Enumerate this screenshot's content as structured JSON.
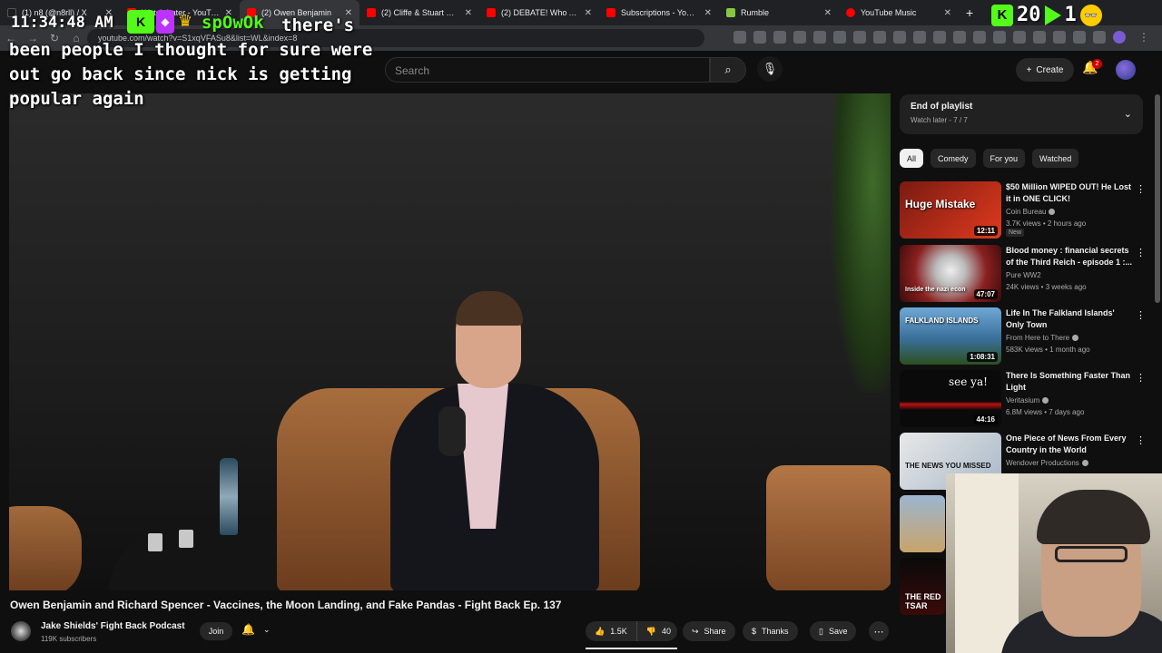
{
  "browser": {
    "tabs": [
      {
        "label": "(1) n8 (@n8rll) / X",
        "color": "#1d1d1d"
      },
      {
        "label": "Watch Later - YouTube",
        "color": "#ff0000"
      },
      {
        "label": "(2) Owen Benjamin",
        "color": "#ff0000",
        "active": true
      },
      {
        "label": "(2) Cliffe & Stuart Knech",
        "color": "#ff0000"
      },
      {
        "label": "(2) DEBATE! Who Are th",
        "color": "#ff0000"
      },
      {
        "label": "Subscriptions - YouTube",
        "color": "#ff0000"
      },
      {
        "label": "Rumble",
        "color": "#85c742"
      },
      {
        "label": "YouTube Music",
        "color": "#ff0000"
      }
    ],
    "new_tab": "+",
    "url": "youtube.com/watch?v=S1xqVFASu8&list=WL&index=8"
  },
  "stream_overlay": {
    "clock": "11:34:48 AM",
    "badge": "K",
    "username": "spOwOk",
    "message": "there's been people I thought for sure were out go back since nick is getting popular again",
    "top_right_k": "K",
    "top_right_num1": "20",
    "top_right_num2": "1"
  },
  "search": {
    "placeholder": "Search"
  },
  "masthead": {
    "create_label": "Create",
    "notification_count": "2"
  },
  "playlist": {
    "title": "End of playlist",
    "subtitle": "Watch later - 7 / 7"
  },
  "chips": [
    "All",
    "Comedy",
    "For you",
    "Watched"
  ],
  "recommendations": [
    {
      "title": "$50 Million WIPED OUT! He Lost it in ONE CLICK!",
      "channel": "Coin Bureau",
      "meta": "3.7K views • 2 hours ago",
      "duration": "12:11",
      "badge": "New",
      "thumb_text": "Huge Mistake",
      "thumb_color": "#7a1a12"
    },
    {
      "title": "Blood money : financial secrets of the Third Reich - episode 1 :...",
      "channel": "Pure WW2",
      "meta": "24K views • 3 weeks ago",
      "duration": "47:07",
      "thumb_text": "Inside the nazi econ",
      "thumb_color": "#8a2020"
    },
    {
      "title": "Life In The Falkland Islands' Only Town",
      "channel": "From Here to There",
      "meta": "583K views • 1 month ago",
      "duration": "1:08:31",
      "thumb_text": "FALKLAND ISLANDS",
      "thumb_color": "#3a6f9a"
    },
    {
      "title": "There Is Something Faster Than Light",
      "channel": "Veritasium",
      "meta": "6.8M views • 7 days ago",
      "duration": "44:16",
      "thumb_text": "see ya!",
      "thumb_color": "#0a0a0a"
    },
    {
      "title": "One Piece of News From Every Country in the World",
      "channel": "Wendover Productions",
      "meta": "",
      "duration": "",
      "thumb_text": "THE NEWS YOU MISSED",
      "thumb_color": "#d8d8d8"
    }
  ],
  "video": {
    "title": "Owen Benjamin and Richard Spencer - Vaccines, the Moon Landing, and Fake Pandas - Fight Back Ep. 137",
    "channel": "Jake Shields' Fight Back Podcast",
    "subscribers": "119K subscribers",
    "join_label": "Join",
    "likes": "1.5K",
    "dislikes": "40",
    "share_label": "Share",
    "thanks_label": "Thanks",
    "save_label": "Save"
  },
  "sidebar_extra_thumbs": [
    "THE RED TSAR"
  ]
}
